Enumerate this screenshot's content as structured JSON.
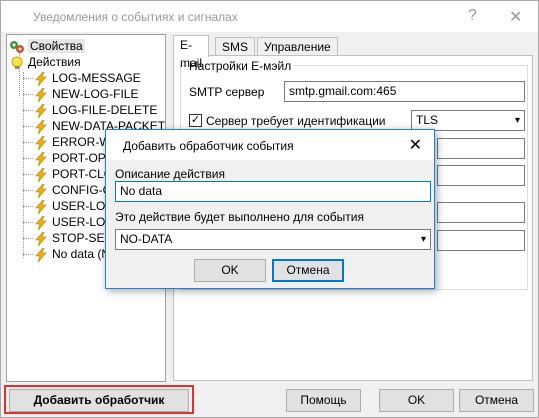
{
  "window": {
    "title": "Уведомления о событиях и сигналах",
    "help_glyph": "?",
    "close_glyph": "✕"
  },
  "tree": {
    "root_items": [
      {
        "label": "Свойства",
        "icon": "gears-icon"
      },
      {
        "label": "Действия",
        "icon": "lightbulb-icon"
      }
    ],
    "actions": [
      "LOG-MESSAGE",
      "NEW-LOG-FILE",
      "LOG-FILE-DELETE",
      "NEW-DATA-PACKET",
      "ERROR-WI",
      "PORT-OPE",
      "PORT-CLO",
      "CONFIG-CH",
      "USER-LOG",
      "USER-LOG",
      "STOP-SER",
      "No data (N"
    ]
  },
  "tabs": [
    "E-mail",
    "SMS",
    "Управление"
  ],
  "email": {
    "group_label": "Настройки Е-мэйл",
    "smtp_label": "SMTP сервер",
    "smtp_value": "smtp.gmail.com:465",
    "auth_label": "Сервер требует идентификации",
    "auth_checked": true,
    "auth_check_glyph": "✓",
    "security_value": "TLS"
  },
  "dialog": {
    "title": "Добавить обработчик события",
    "close_glyph": "✕",
    "description_label": "Описание действия",
    "description_value": "No data",
    "event_label": "Это действие будет выполнено для события",
    "event_value": "NO-DATA",
    "ok_label": "OK",
    "cancel_label": "Отмена"
  },
  "footer": {
    "add_handler_label": "Добавить обработчик",
    "help_label": "Помощь",
    "ok_label": "OK",
    "cancel_label": "Отмена"
  },
  "colors": {
    "accent": "#0078d7",
    "highlight": "#e53030"
  }
}
